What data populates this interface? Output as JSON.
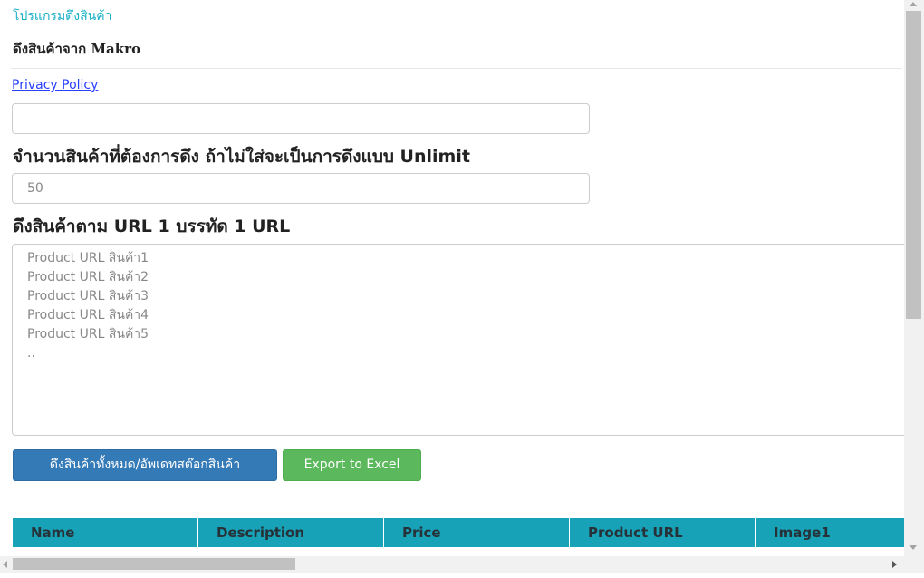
{
  "app": {
    "title": "โปรแกรมดึงสินค้า",
    "subtitle": "ดึงสินค้าจาก Makro"
  },
  "links": {
    "privacy_label": "Privacy Policy"
  },
  "form": {
    "first_input": {
      "value": "",
      "placeholder": ""
    },
    "quantity_label": "จำนวนสินค้าที่ต้องการดึง ถ้าไม่ใส่จะเป็นการดึงแบบ Unlimit",
    "quantity_input": {
      "value": "",
      "placeholder": "50"
    },
    "urls_label": "ดึงสินค้าตาม URL 1 บรรทัด 1 URL",
    "urls_textarea": {
      "value": "",
      "placeholder": "Product URL สินค้า1\nProduct URL สินค้า2\nProduct URL สินค้า3\nProduct URL สินค้า4\nProduct URL สินค้า5\n.."
    }
  },
  "buttons": {
    "fetch_label": "ดึงสินค้าทั้งหมด/อัพเดทสต๊อกสินค้า",
    "export_label": "Export to Excel"
  },
  "colors": {
    "title_accent": "#1ab0c6",
    "fetch_button": "#337ab7",
    "export_button": "#5cb85c",
    "table_header": "#17a2b8"
  },
  "table": {
    "columns": [
      "Name",
      "Description",
      "Price",
      "Product URL",
      "Image1"
    ]
  },
  "scrollbars": {
    "vertical": {
      "up_icon": "arrow-up-icon",
      "down_icon": "arrow-down-icon"
    },
    "horizontal": {
      "left_icon": "arrow-left-icon",
      "right_icon": "arrow-right-icon"
    }
  }
}
